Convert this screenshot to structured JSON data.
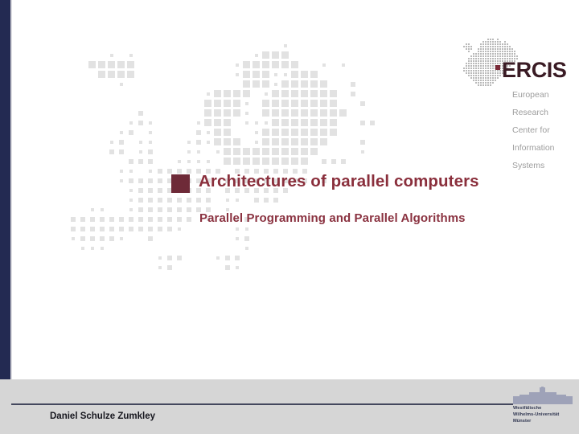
{
  "slide": {
    "title": "Architectures of parallel computers",
    "subtitle": "Parallel Programming and Parallel Algorithms"
  },
  "ercis_logo": {
    "wordmark": "ERCIS",
    "tagline_lines": [
      "European",
      "Research",
      "Center for",
      "Information",
      "Systems"
    ],
    "map_icon": "europe-dot-map-icon",
    "marker_icon": "location-marker-icon"
  },
  "footer": {
    "presenter": "Daniel Schulze Zumkley"
  },
  "wwu_logo": {
    "building_icon": "schloss-building-icon",
    "lines": [
      "Westfälische",
      "Wilhelms-Universität",
      "Münster"
    ]
  },
  "decorations": {
    "background_map": "europe-dot-map-background",
    "highlight_marker": "muenster-highlight-marker",
    "left_bar": "navy-accent-bar"
  },
  "colors": {
    "navy_bar": "#232a52",
    "title_maroon": "#8a2f3c",
    "marker_maroon": "#6e2a38",
    "map_dot_gray": "#e2e2e2",
    "footer_band": "#d6d6d6",
    "tagline_gray": "#9d9d9d",
    "wwu_text": "#2f3550"
  }
}
